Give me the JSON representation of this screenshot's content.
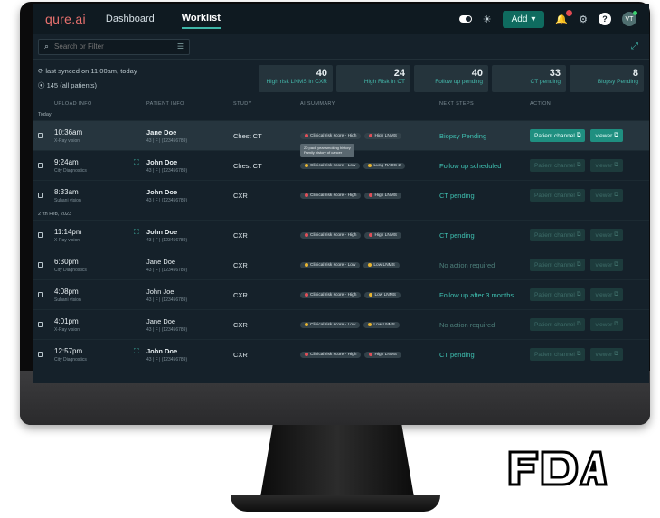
{
  "app": {
    "logo": "qure.ai",
    "tabs": [
      {
        "label": "Dashboard",
        "active": false
      },
      {
        "label": "Worklist",
        "active": true
      }
    ]
  },
  "header": {
    "add_label": "Add",
    "avatar_initials": "VT"
  },
  "search": {
    "placeholder": "Search or Filter"
  },
  "sync": {
    "text": "last synced on 11:00am, today",
    "patients": "145 (all patients)"
  },
  "stats": [
    {
      "num": "40",
      "label": "High risk LNMS in CXR"
    },
    {
      "num": "24",
      "label": "High Risk in CT"
    },
    {
      "num": "40",
      "label": "Follow up pending"
    },
    {
      "num": "33",
      "label": "CT pending"
    },
    {
      "num": "8",
      "label": "Biopsy Pending"
    }
  ],
  "columns": [
    "UPLOAD INFO",
    "PATIENT INFO",
    "STUDY",
    "AI SUMMARY",
    "NEXT STEPS",
    "ACTION"
  ],
  "sections": [
    "Today",
    "27th Feb, 2023"
  ],
  "tooltip": [
    "20 pack year smoking history",
    "Family history of cancer"
  ],
  "action_labels": {
    "patient": "Patient channel",
    "viewer": "viewer"
  },
  "rows": [
    {
      "time": "10:36am",
      "site": "X-Ray vision",
      "name": "Jane Doe",
      "meta": "43 | F | (123456789)",
      "study": "Chest CT",
      "risk": "Clinical risk score - High",
      "tag": "High LNMS",
      "next": "Biopsy Pending"
    },
    {
      "time": "9:24am",
      "site": "City Diagnostics",
      "name": "John Doe",
      "meta": "43 | F | (123456789)",
      "study": "Chest CT",
      "risk": "Clinical risk score - Low",
      "tag": "Lung-RADS 2",
      "next": "Follow up scheduled"
    },
    {
      "time": "8:33am",
      "site": "Suhani vision",
      "name": "John Doe",
      "meta": "43 | F | (123456789)",
      "study": "CXR",
      "risk": "Clinical risk score - High",
      "tag": "High LNMS",
      "next": "CT pending"
    },
    {
      "time": "11:14pm",
      "site": "X-Ray vision",
      "name": "John Doe",
      "meta": "43 | F | (123456789)",
      "study": "CXR",
      "risk": "Clinical risk score - High",
      "tag": "High LNMS",
      "next": "CT pending"
    },
    {
      "time": "6:30pm",
      "site": "City Diagnostics",
      "name": "Jane Doe",
      "meta": "43 | F | (123456789)",
      "study": "CXR",
      "risk": "Clinical risk score - Low",
      "tag": "Low LNMS",
      "next": "No action required"
    },
    {
      "time": "4:08pm",
      "site": "Suhani vision",
      "name": "John Joe",
      "meta": "43 | F | (123456789)",
      "study": "CXR",
      "risk": "Clinical risk score - High",
      "tag": "Low LNMS",
      "next": "Follow up after 3 months"
    },
    {
      "time": "4:01pm",
      "site": "X-Ray vision",
      "name": "Jane Doe",
      "meta": "43 | F | (123456789)",
      "study": "CXR",
      "risk": "Clinical risk score - Low",
      "tag": "Low LNMS",
      "next": "No action required"
    },
    {
      "time": "12:57pm",
      "site": "City Diagnostics",
      "name": "John Doe",
      "meta": "43 | F | (123456789)",
      "study": "CXR",
      "risk": "Clinical risk score - High",
      "tag": "High LNMS",
      "next": "CT pending"
    }
  ],
  "fda_logo": "FDA"
}
